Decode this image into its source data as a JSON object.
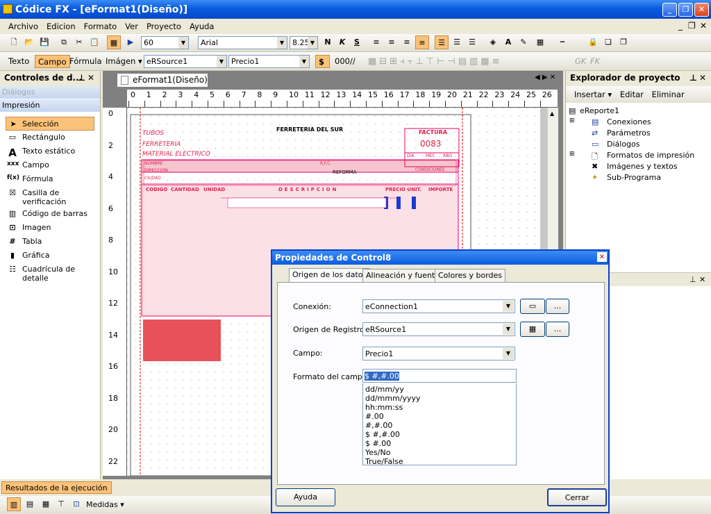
{
  "window": {
    "title": "Códice FX - [eFormat1(Diseño)]"
  },
  "menu": [
    "Archivo",
    "Edicion",
    "Formato",
    "Ver",
    "Proyecto",
    "Ayuda"
  ],
  "toolbar": {
    "zoom": "60",
    "font": "Arial",
    "font_size": "8.25",
    "bold": "N",
    "italic": "K",
    "underline": "S"
  },
  "toolbar2": {
    "texto": "Texto",
    "campo": "Campo",
    "formula": "Fórmula",
    "imagen": "Imágen",
    "source": "eRSource1",
    "field": "Precio1",
    "currency": "$",
    "thousands": "000",
    "slashes": "//",
    "gk": "GK",
    "fk": "FK"
  },
  "left_panel": {
    "title": "Controles de d...",
    "section_dialogos": "Diálogos",
    "section_impresion": "Impresión",
    "tools": [
      {
        "label": "Selección",
        "icon": "arrow-icon"
      },
      {
        "label": "Rectángulo",
        "icon": "rectangle-icon"
      },
      {
        "label": "Texto estático",
        "icon": "text-icon"
      },
      {
        "label": "Campo",
        "icon": "field-icon"
      },
      {
        "label": "Fórmula",
        "icon": "formula-icon"
      },
      {
        "label": "Casilla de verificación",
        "icon": "checkbox-icon"
      },
      {
        "label": "Código de barras",
        "icon": "barcode-icon"
      },
      {
        "label": "Imagen",
        "icon": "image-icon"
      },
      {
        "label": "Tabla",
        "icon": "table-icon"
      },
      {
        "label": "Gráfica",
        "icon": "chart-icon"
      },
      {
        "label": "Cuadrícula de detalle",
        "icon": "grid-icon"
      }
    ]
  },
  "doc": {
    "tab": "eFormat1(Diseño)",
    "hruler": [
      "0",
      "1",
      "2",
      "3",
      "4",
      "5",
      "6",
      "7",
      "8",
      "9",
      "10",
      "11",
      "12",
      "13",
      "14",
      "15",
      "16",
      "17",
      "18",
      "19",
      "20",
      "21",
      "22",
      "23",
      "24",
      "25",
      "26"
    ],
    "vruler": [
      "0",
      "2",
      "4",
      "6",
      "8",
      "10",
      "12",
      "14",
      "16",
      "18",
      "20",
      "22"
    ]
  },
  "form": {
    "tubos": "TUBOS",
    "ferreteria": "FERRETERIA",
    "material": "MATERIAL ELECTRICO",
    "store": "FERRETERIA DEL SUR",
    "factura": "FACTURA",
    "folio": "0083",
    "dia": "DIA",
    "mes": "MES",
    "ano": "AÑO",
    "nombre": "NOMBRE",
    "direccion": "DIRECCION",
    "ciudad": "CIUDAD",
    "rfc": "R.F.C.",
    "condiciones": "CONDICIONES",
    "reforma": "REFORMA",
    "codigo": "CODIGO",
    "cantidad": "CANTIDAD",
    "unidad": "UNIDAD",
    "descripcion": "DESCRIPCION",
    "precio": "PRECIO UNIT.",
    "importe": "IMPORTE"
  },
  "right_panel": {
    "title": "Explorador de proyecto",
    "insertar": "Insertar",
    "editar": "Editar",
    "eliminar": "Eliminar",
    "root": "eReporte1",
    "items": [
      "Conexiones",
      "Parámetros",
      "Diálogos",
      "Formatos de impresión",
      "Imágenes y textos",
      "Sub-Programa"
    ]
  },
  "dialog": {
    "title": "Propiedades de Control8",
    "tabs": [
      "Origen de los datos",
      "Alineación y fuente",
      "Colores y bordes"
    ],
    "conexion_label": "Conexión:",
    "conexion_value": "eConnection1",
    "origen_label": "Origen de Registros:",
    "origen_value": "eRSource1",
    "campo_label": "Campo:",
    "campo_value": "Precio1",
    "formato_label": "Formato del campo:",
    "formato_value": "$ #,#.00",
    "formats": [
      "dd/mm/yy",
      "dd/mmm/yyyy",
      "hh:mm:ss",
      "#.00",
      "#,#.00",
      "$ #,#.00",
      "$ #.00",
      "Yes/No",
      "True/False"
    ],
    "ellipsis": "...",
    "help": "Ayuda",
    "close": "Cerrar"
  },
  "bottom": {
    "results_tab": "Resultados de la ejecución",
    "measures": "Medidas"
  }
}
